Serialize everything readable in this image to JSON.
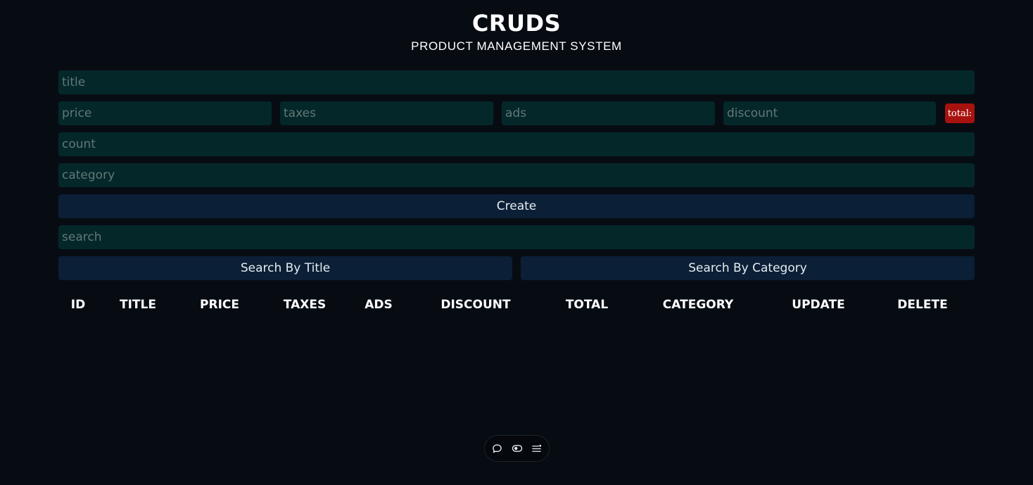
{
  "header": {
    "title": "CRUDS",
    "subtitle": "PRODUCT MANAGEMENT SYSTEM"
  },
  "form": {
    "title_placeholder": "title",
    "price_placeholder": "price",
    "taxes_placeholder": "taxes",
    "ads_placeholder": "ads",
    "discount_placeholder": "discount",
    "total_label": "total:",
    "count_placeholder": "count",
    "category_placeholder": "category",
    "create_label": "Create"
  },
  "search": {
    "placeholder": "search",
    "by_title_label": "Search By Title",
    "by_category_label": "Search By Category"
  },
  "table": {
    "headers": [
      "ID",
      "TITLE",
      "PRICE",
      "TAXES",
      "ADS",
      "DISCOUNT",
      "TOTAL",
      "CATEGORY",
      "UPDATE",
      "DELETE"
    ]
  },
  "toolbar": {
    "icons": [
      "comment-icon",
      "toggle-icon",
      "menu-icon"
    ]
  },
  "colors": {
    "background": "#070c13",
    "input": "#04272a",
    "button": "#0b1f36",
    "total_badge": "#a8120e"
  }
}
